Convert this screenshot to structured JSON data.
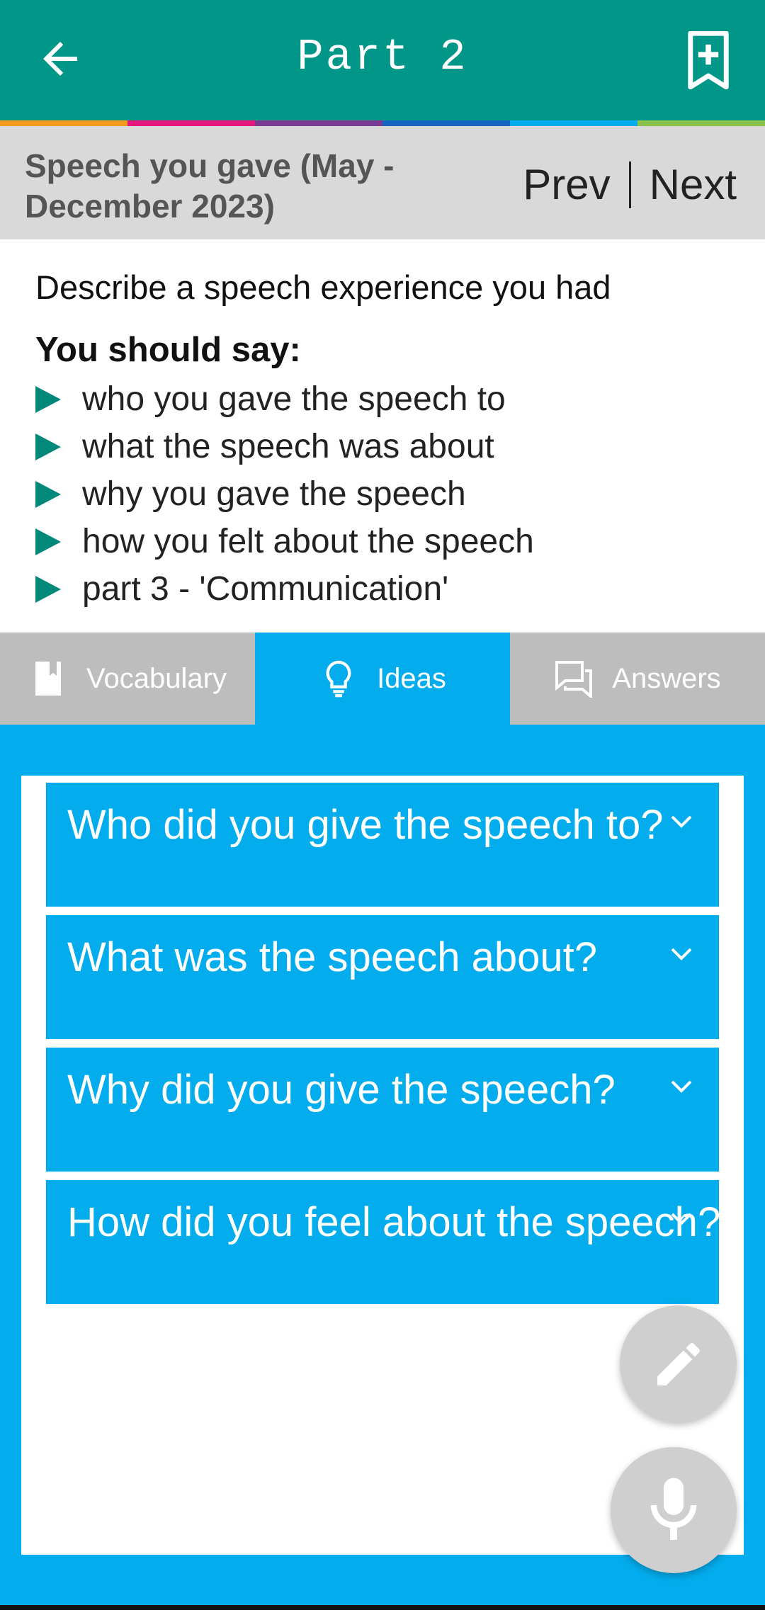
{
  "app_bar": {
    "title": "Part 2",
    "back_icon": "arrow-left-icon",
    "bookmark_icon": "bookmark-add-icon"
  },
  "stripe_colors": [
    "#f29b1f",
    "#e3177c",
    "#7a3a93",
    "#1565c0",
    "#03aded",
    "#8bc34a"
  ],
  "topic": {
    "title": "Speech you gave (May - December 2023)",
    "prev_label": "Prev",
    "next_label": "Next"
  },
  "cue_card": {
    "description": "Describe a speech experience you had",
    "should_say": "You should say:",
    "points": [
      "who you gave the speech to",
      "what the speech was about",
      "why you gave the speech",
      "how you felt about the speech",
      "part 3 - 'Communication'"
    ]
  },
  "tabs": [
    {
      "label": "Vocabulary",
      "icon": "book-icon",
      "active": false
    },
    {
      "label": "Ideas",
      "icon": "lightbulb-icon",
      "active": true
    },
    {
      "label": "Answers",
      "icon": "chat-icon",
      "active": false
    }
  ],
  "accordion": [
    {
      "question": "Who did you give the speech to?"
    },
    {
      "question": "What was the speech about?"
    },
    {
      "question": "Why did you give the speech?"
    },
    {
      "question": "How did you feel about the speech?"
    }
  ],
  "colors": {
    "app_bar": "#009688",
    "accent_blue": "#03aded",
    "bullet_green": "#00897b",
    "tab_inactive": "#bdbdbd"
  }
}
